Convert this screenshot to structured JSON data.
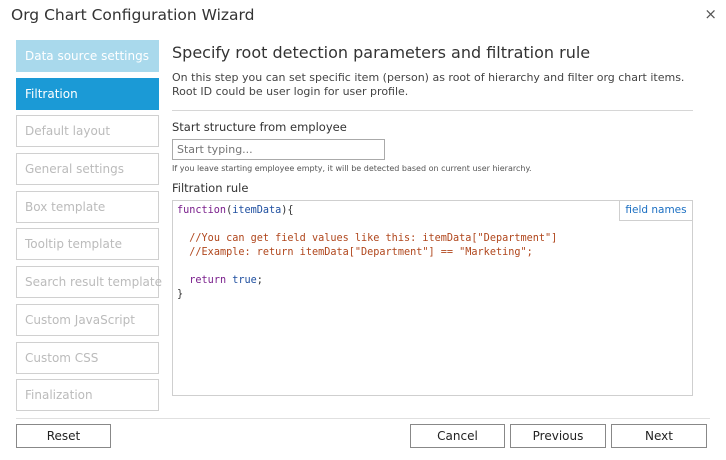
{
  "window": {
    "title": "Org Chart Configuration Wizard",
    "close_glyph": "×"
  },
  "steps": [
    {
      "label": "Data source settings",
      "state": "done"
    },
    {
      "label": "Filtration",
      "state": "active"
    },
    {
      "label": "Default layout",
      "state": "disabled"
    },
    {
      "label": "General settings",
      "state": "disabled"
    },
    {
      "label": "Box template",
      "state": "disabled"
    },
    {
      "label": "Tooltip template",
      "state": "disabled"
    },
    {
      "label": "Search result template",
      "state": "disabled"
    },
    {
      "label": "Custom JavaScript",
      "state": "disabled"
    },
    {
      "label": "Custom CSS",
      "state": "disabled"
    },
    {
      "label": "Finalization",
      "state": "disabled"
    }
  ],
  "main": {
    "heading": "Specify root detection parameters and filtration rule",
    "description": "On this step you can set specific item (person) as root of hierarchy and filter org chart items. Root ID could be user login for user profile.",
    "start_label": "Start structure from employee",
    "start_placeholder": "Start typing...",
    "start_hint": "If you leave starting employee empty, it will be detected based on current user hierarchy.",
    "filtration_label": "Filtration rule",
    "field_names_link": "field names",
    "code": {
      "l1_kw": "function",
      "l1_open": "(",
      "l1_arg": "itemData",
      "l1_close": "){",
      "comment1": "//You can get field values like this: itemData[\"Department\"]",
      "comment2": "//Example: return itemData[\"Department\"] == \"Marketing\";",
      "ret_kw": "return",
      "ret_val": "true",
      "ret_end": ";",
      "close_brace": "}"
    }
  },
  "footer": {
    "reset": "Reset",
    "cancel": "Cancel",
    "previous": "Previous",
    "next": "Next"
  },
  "colors": {
    "active_step": "#1b9ad6",
    "done_step": "#a9d9ec",
    "link": "#1b6fc2",
    "keyword": "#7a1f8c",
    "comment": "#b0461c"
  }
}
